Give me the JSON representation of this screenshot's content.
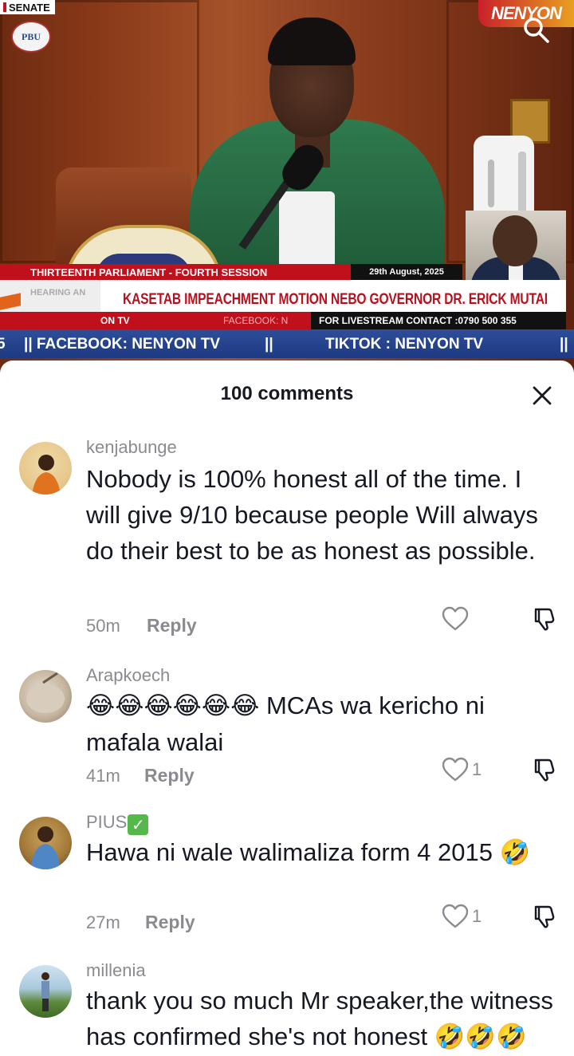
{
  "video": {
    "channel_badge": "SENATE",
    "pbu_logo": "PBU",
    "nenyon_logo": "NENYON",
    "session_line": "THIRTEENTH PARLIAMENT - FOURTH SESSION",
    "date": "29th August, 2025",
    "hearing_tag": "HEARING AN",
    "headline": "KASETAB IMPEACHMENT MOTION NEBO GOVERNOR DR. ERICK MUTAI",
    "social_tv": "ON TV",
    "social_facebook": "FACEBOOK: N",
    "contact": "FOR LIVESTREAM CONTACT :0790 500 355",
    "ticker": [
      "5",
      "|| FACEBOOK:  NENYON TV",
      "||",
      "TIKTOK :  NENYON TV",
      "||"
    ]
  },
  "comments_panel": {
    "count_label": "100 comments",
    "close_icon": "close-icon",
    "colors": {
      "text": "#161823",
      "muted": "#8a8b91",
      "ticker": "#1d3a82",
      "accent_red": "#c0101c"
    }
  },
  "comments": [
    {
      "username": "kenjabunge",
      "text": "Nobody is 100% honest all of the time. I will give 9/10 because people Will always do their best to be as honest as possible.",
      "time": "50m",
      "reply_label": "Reply",
      "likes": ""
    },
    {
      "username": "Arapkoech",
      "emoji": "😂😂😂😂😂😂",
      "text": " MCAs wa kericho ni mafala walai",
      "time": "41m",
      "reply_label": "Reply",
      "likes": "1"
    },
    {
      "username": "PIUS",
      "verified_mark": "✓",
      "text": "Hawa ni wale walimaliza form 4 2015",
      "emoji": "🤣",
      "time": "27m",
      "reply_label": "Reply",
      "likes": "1"
    },
    {
      "username": "millenia",
      "text": "thank you so much Mr speaker,the witness has confirmed she's not",
      "partial_tail": "honest 🤣🤣🤣🤣"
    }
  ]
}
